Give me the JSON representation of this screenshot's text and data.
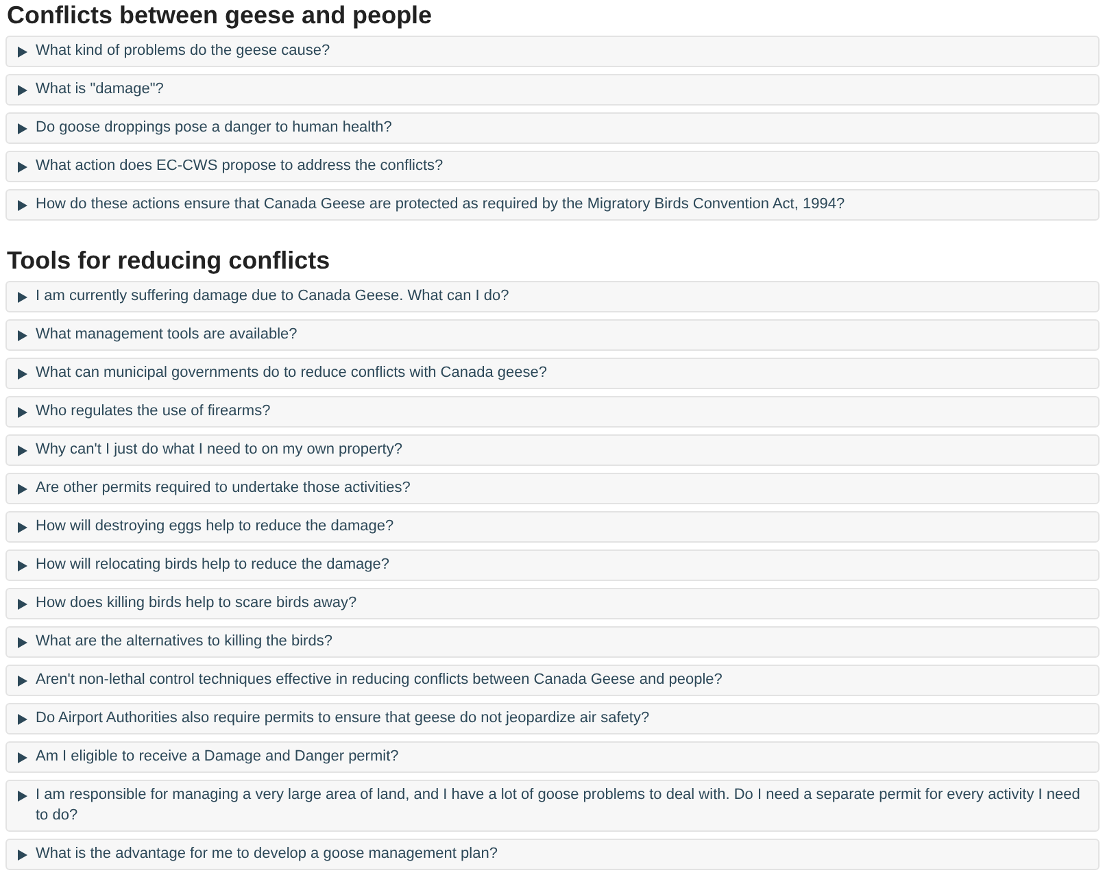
{
  "sections": [
    {
      "title": "Conflicts between geese and people",
      "items": [
        {
          "question": "What kind of problems do the geese cause?",
          "expanded": false
        },
        {
          "question": "What is \"damage\"?",
          "expanded": false
        },
        {
          "question": "Do goose droppings pose a danger to human health?",
          "expanded": false
        },
        {
          "question": "What action does EC-CWS propose to address the conflicts?",
          "expanded": false
        },
        {
          "question": "How do these actions ensure that Canada Geese are protected as required by the Migratory Birds Convention Act, 1994?",
          "expanded": false
        }
      ]
    },
    {
      "title": "Tools for reducing conflicts",
      "items": [
        {
          "question": "I am currently suffering damage due to Canada Geese. What can I do?",
          "expanded": false
        },
        {
          "question": "What management tools are available?",
          "expanded": false
        },
        {
          "question": "What can municipal governments do to reduce conflicts with Canada geese?",
          "expanded": false
        },
        {
          "question": "Who regulates the use of firearms?",
          "expanded": false
        },
        {
          "question": "Why can't I just do what I need to on my own property?",
          "expanded": false
        },
        {
          "question": "Are other permits required to undertake those activities?",
          "expanded": false
        },
        {
          "question": "How will destroying eggs help to reduce the damage?",
          "expanded": false
        },
        {
          "question": "How will relocating birds help to reduce the damage?",
          "expanded": false
        },
        {
          "question": "How does killing birds help to scare birds away?",
          "expanded": false
        },
        {
          "question": "What are the alternatives to killing the birds?",
          "expanded": false
        },
        {
          "question": "Aren't non-lethal control techniques effective in reducing conflicts between Canada Geese and people?",
          "expanded": false
        },
        {
          "question": "Do Airport Authorities also require permits to ensure that geese do not jeopardize air safety?",
          "expanded": false
        },
        {
          "question": "Am I eligible to receive a Damage and Danger permit?",
          "expanded": false
        },
        {
          "question": "I am responsible for managing a very large area of land, and I have a lot of goose problems to deal with. Do I need a separate permit for every activity I need to do?",
          "expanded": false
        },
        {
          "question": "What is the advantage for me to develop a goose management plan?",
          "expanded": false
        }
      ]
    }
  ]
}
